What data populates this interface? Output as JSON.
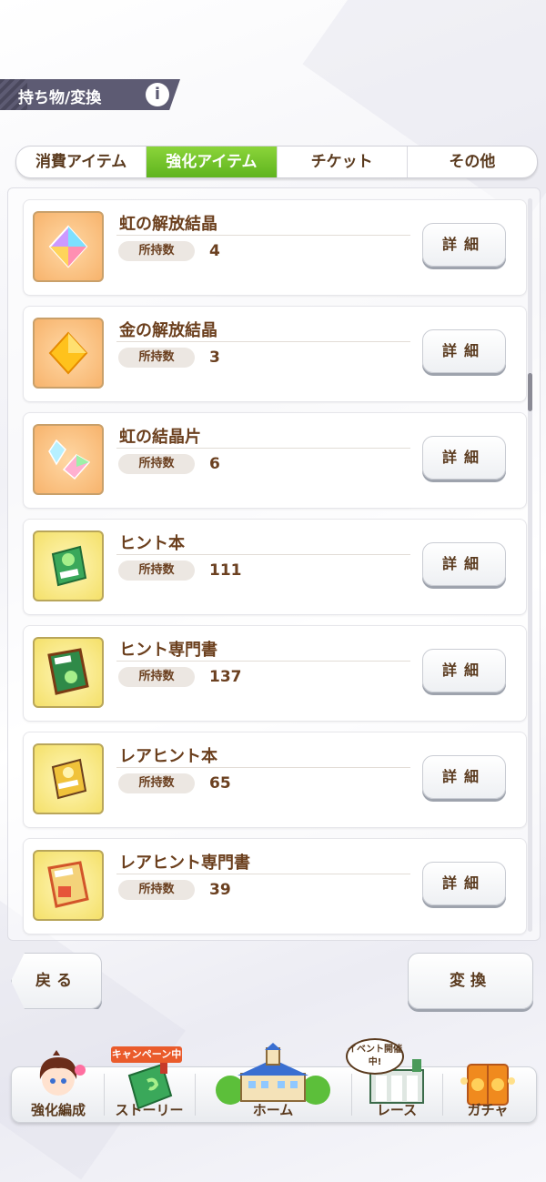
{
  "header": {
    "title": "持ち物/変換",
    "info_icon": "i"
  },
  "tabs": [
    {
      "label": "消費アイテム",
      "active": false
    },
    {
      "label": "強化アイテム",
      "active": true
    },
    {
      "label": "チケット",
      "active": false
    },
    {
      "label": "その他",
      "active": false
    }
  ],
  "items": [
    {
      "name": "虹の解放結晶",
      "count_label": "所持数",
      "count": "4",
      "icon": "rainbow-crystal-icon",
      "detail_label": "詳細"
    },
    {
      "name": "金の解放結晶",
      "count_label": "所持数",
      "count": "3",
      "icon": "gold-crystal-icon",
      "detail_label": "詳細"
    },
    {
      "name": "虹の結晶片",
      "count_label": "所持数",
      "count": "6",
      "icon": "rainbow-shard-icon",
      "detail_label": "詳細"
    },
    {
      "name": "ヒント本",
      "count_label": "所持数",
      "count": "111",
      "icon": "hint-book-icon",
      "detail_label": "詳細"
    },
    {
      "name": "ヒント専門書",
      "count_label": "所持数",
      "count": "137",
      "icon": "hint-expert-book-icon",
      "detail_label": "詳細"
    },
    {
      "name": "レアヒント本",
      "count_label": "所持数",
      "count": "65",
      "icon": "rare-hint-book-icon",
      "detail_label": "詳細"
    },
    {
      "name": "レアヒント専門書",
      "count_label": "所持数",
      "count": "39",
      "icon": "rare-hint-expert-book-icon",
      "detail_label": "詳細"
    }
  ],
  "buttons": {
    "back": "戻る",
    "convert": "変換"
  },
  "nav": {
    "campaign_badge": "キャンペーン中",
    "event_badge": "イベント開催中!",
    "items": [
      {
        "label": "強化編成",
        "icon": "character-icon"
      },
      {
        "label": "ストーリー",
        "icon": "story-book-icon"
      },
      {
        "label": "ホーム",
        "icon": "school-building-icon"
      },
      {
        "label": "レース",
        "icon": "race-gate-icon"
      },
      {
        "label": "ガチャ",
        "icon": "gacha-door-icon"
      }
    ]
  },
  "colors": {
    "active_tab": "#6cc127",
    "text_brown": "#6b4020",
    "header_bg": "#5d5b73",
    "campaign": "#ea5b2b"
  }
}
